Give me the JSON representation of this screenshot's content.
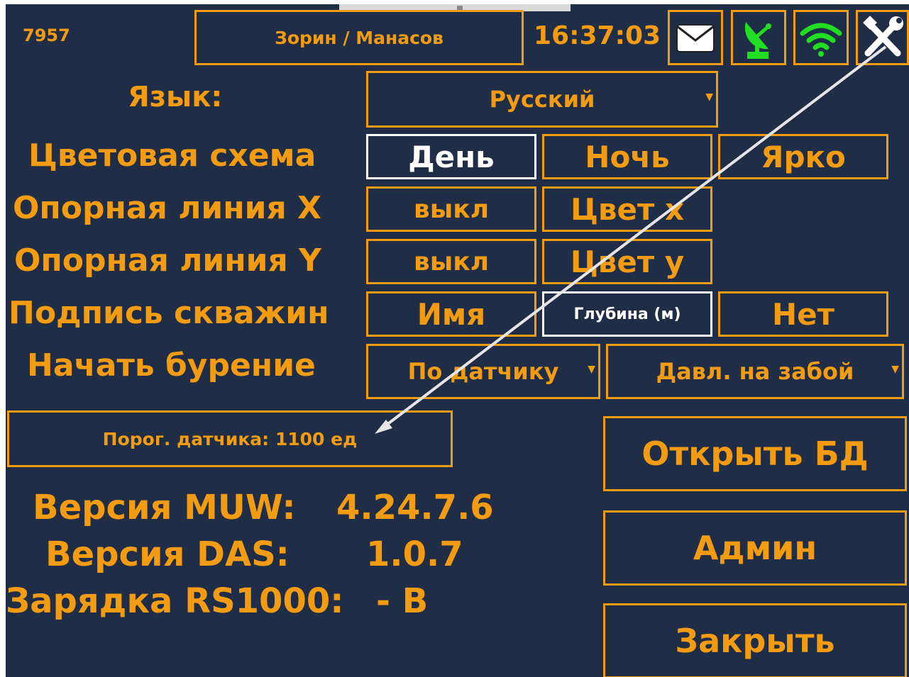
{
  "header": {
    "id": "7957",
    "crew": "Зорин / Манасов",
    "time": "16:37:03"
  },
  "icons": [
    "mail-icon",
    "satellite-icon",
    "wifi-icon",
    "settings-tools-icon"
  ],
  "colors": {
    "background": "#1f2d47",
    "accent": "#f39c12",
    "selected": "#ffffff",
    "status_ok": "#22dd22"
  },
  "settings": {
    "language": {
      "label": "Язык:",
      "value": "Русский"
    },
    "color_scheme": {
      "label": "Цветовая схема",
      "options": [
        "День",
        "Ночь",
        "Ярко"
      ],
      "selected": "День"
    },
    "ref_line_x": {
      "label": "Опорная линия X",
      "toggle": "выкл",
      "color_btn": "Цвет x"
    },
    "ref_line_y": {
      "label": "Опорная линия Y",
      "toggle": "выкл",
      "color_btn": "Цвет y"
    },
    "well_label": {
      "label": "Подпись скважин",
      "options": [
        "Имя",
        "Глубина (м)",
        "Нет"
      ],
      "selected": "Глубина (м)"
    },
    "start_drilling": {
      "label": "Начать бурение",
      "trigger": "По датчику",
      "parameter": "Давл. на забой"
    },
    "sensor_threshold": "Порог. датчика: 1100 ед"
  },
  "info": {
    "muw_label": "Версия MUW:",
    "muw_value": "4.24.7.6",
    "das_label": "Версия DAS:",
    "das_value": "1.0.7",
    "charge_label": "Зарядка RS1000:",
    "charge_value": "- В"
  },
  "buttons": {
    "open_db": "Открыть БД",
    "admin": "Админ",
    "close": "Закрыть"
  }
}
